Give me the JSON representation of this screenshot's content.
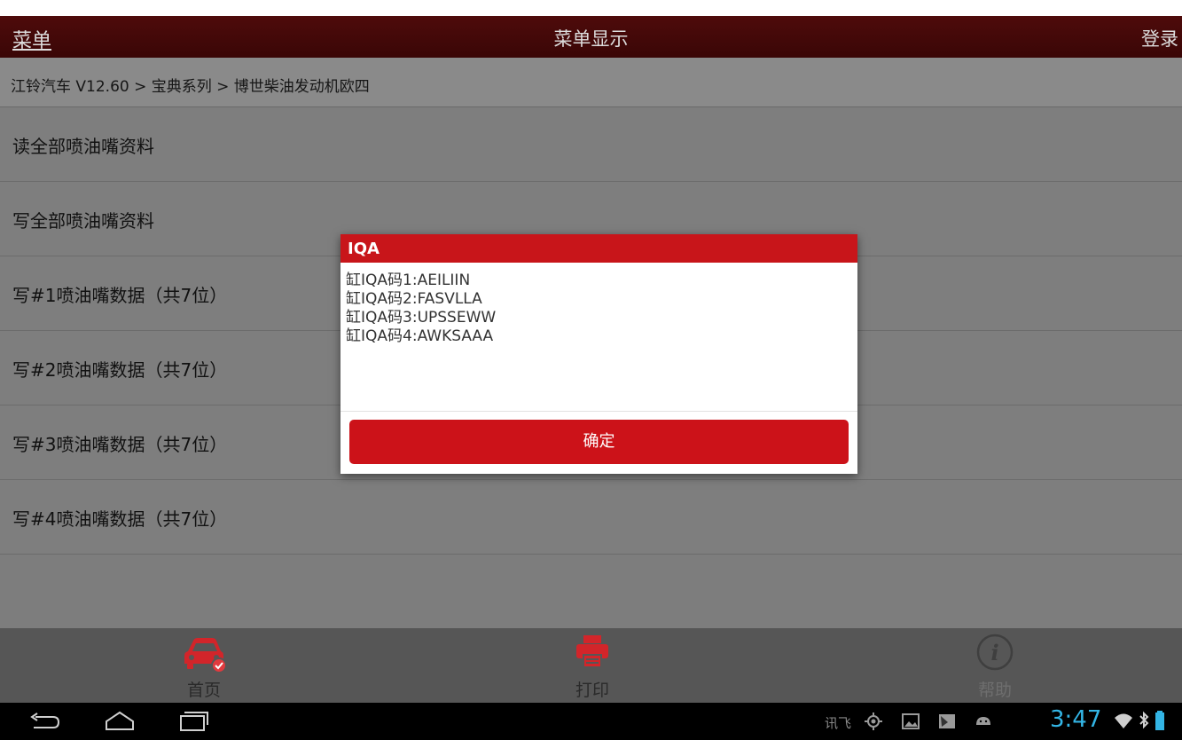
{
  "app": {
    "menu_label": "菜单",
    "title": "菜单显示",
    "login_label": "登录"
  },
  "breadcrumb": "江铃汽车 V12.60 > 宝典系列 > 博世柴油发动机欧四",
  "menu_items": [
    "读全部喷油嘴资料",
    "写全部喷油嘴资料",
    "写#1喷油嘴数据（共7位）",
    "写#2喷油嘴数据（共7位）",
    "写#3喷油嘴数据（共7位）",
    "写#4喷油嘴数据（共7位）"
  ],
  "dialog": {
    "title": "IQA",
    "lines": [
      "缸IQA码1:AEILIIN",
      "缸IQA码2:FASVLLA",
      "缸IQA码3:UPSSEWW",
      "缸IQA码4:AWKSAAA"
    ],
    "ok_label": "确定"
  },
  "bottom_nav": {
    "home_label": "首页",
    "print_label": "打印",
    "help_label": "帮助"
  },
  "status_bar": {
    "ime_label": "讯飞",
    "time": "3:47"
  },
  "colors": {
    "titlebar": "#4e0b0b",
    "accent_red": "#c8151a",
    "home_icon": "#d2252a",
    "time_text": "#33b5e5"
  },
  "icons": {
    "home": "car-icon",
    "print": "printer-icon",
    "help": "info-icon",
    "sys_back": "back-icon",
    "sys_home": "home-icon",
    "sys_recent": "recent-apps-icon"
  }
}
